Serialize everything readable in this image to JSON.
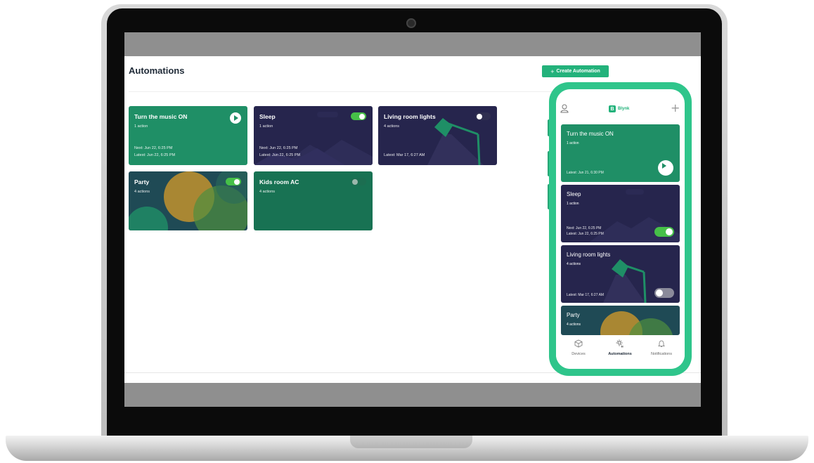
{
  "web": {
    "title": "Automations",
    "create_button": "Create Automation",
    "create_icon": "+",
    "cards": [
      {
        "title": "Turn the music ON",
        "subtitle": "1 action",
        "next": "Next: Jun 22, 6:25 PM",
        "latest": "Latest: Jun 22, 6:25 PM"
      },
      {
        "title": "Sleep",
        "subtitle": "1 action",
        "next": "Next: Jun 22, 6:25 PM",
        "latest": "Latest: Jun 22, 6:25 PM"
      },
      {
        "title": "Living room lights",
        "subtitle": "4 actions",
        "latest": "Latest: Mar 17, 6:27 AM"
      },
      {
        "title": "Party",
        "subtitle": "4 actions"
      },
      {
        "title": "Kids room AC",
        "subtitle": "4 actions"
      }
    ]
  },
  "phone": {
    "brand_letter": "B",
    "brand": "Blynk",
    "add_icon": "+",
    "cards": [
      {
        "title": "Turn the music ON",
        "subtitle": "1 action",
        "latest": "Latest: Jun 21, 6:30 PM"
      },
      {
        "title": "Sleep",
        "subtitle": "1 action",
        "next": "Next: Jun 22, 6:25 PM",
        "latest": "Latest: Jun 22, 6:25 PM"
      },
      {
        "title": "Living room lights",
        "subtitle": "4 actions",
        "latest": "Latest: Mar 17, 6:27 AM"
      },
      {
        "title": "Party",
        "subtitle": "4 actions"
      }
    ],
    "nav": [
      {
        "label": "Devices"
      },
      {
        "label": "Automations"
      },
      {
        "label": "Notifications"
      }
    ]
  },
  "colors": {
    "accent": "#23b27b",
    "card_green": "#1f8f66",
    "card_green_dark": "#187253",
    "card_navy": "#26254d",
    "toggle_on": "#46c048"
  }
}
